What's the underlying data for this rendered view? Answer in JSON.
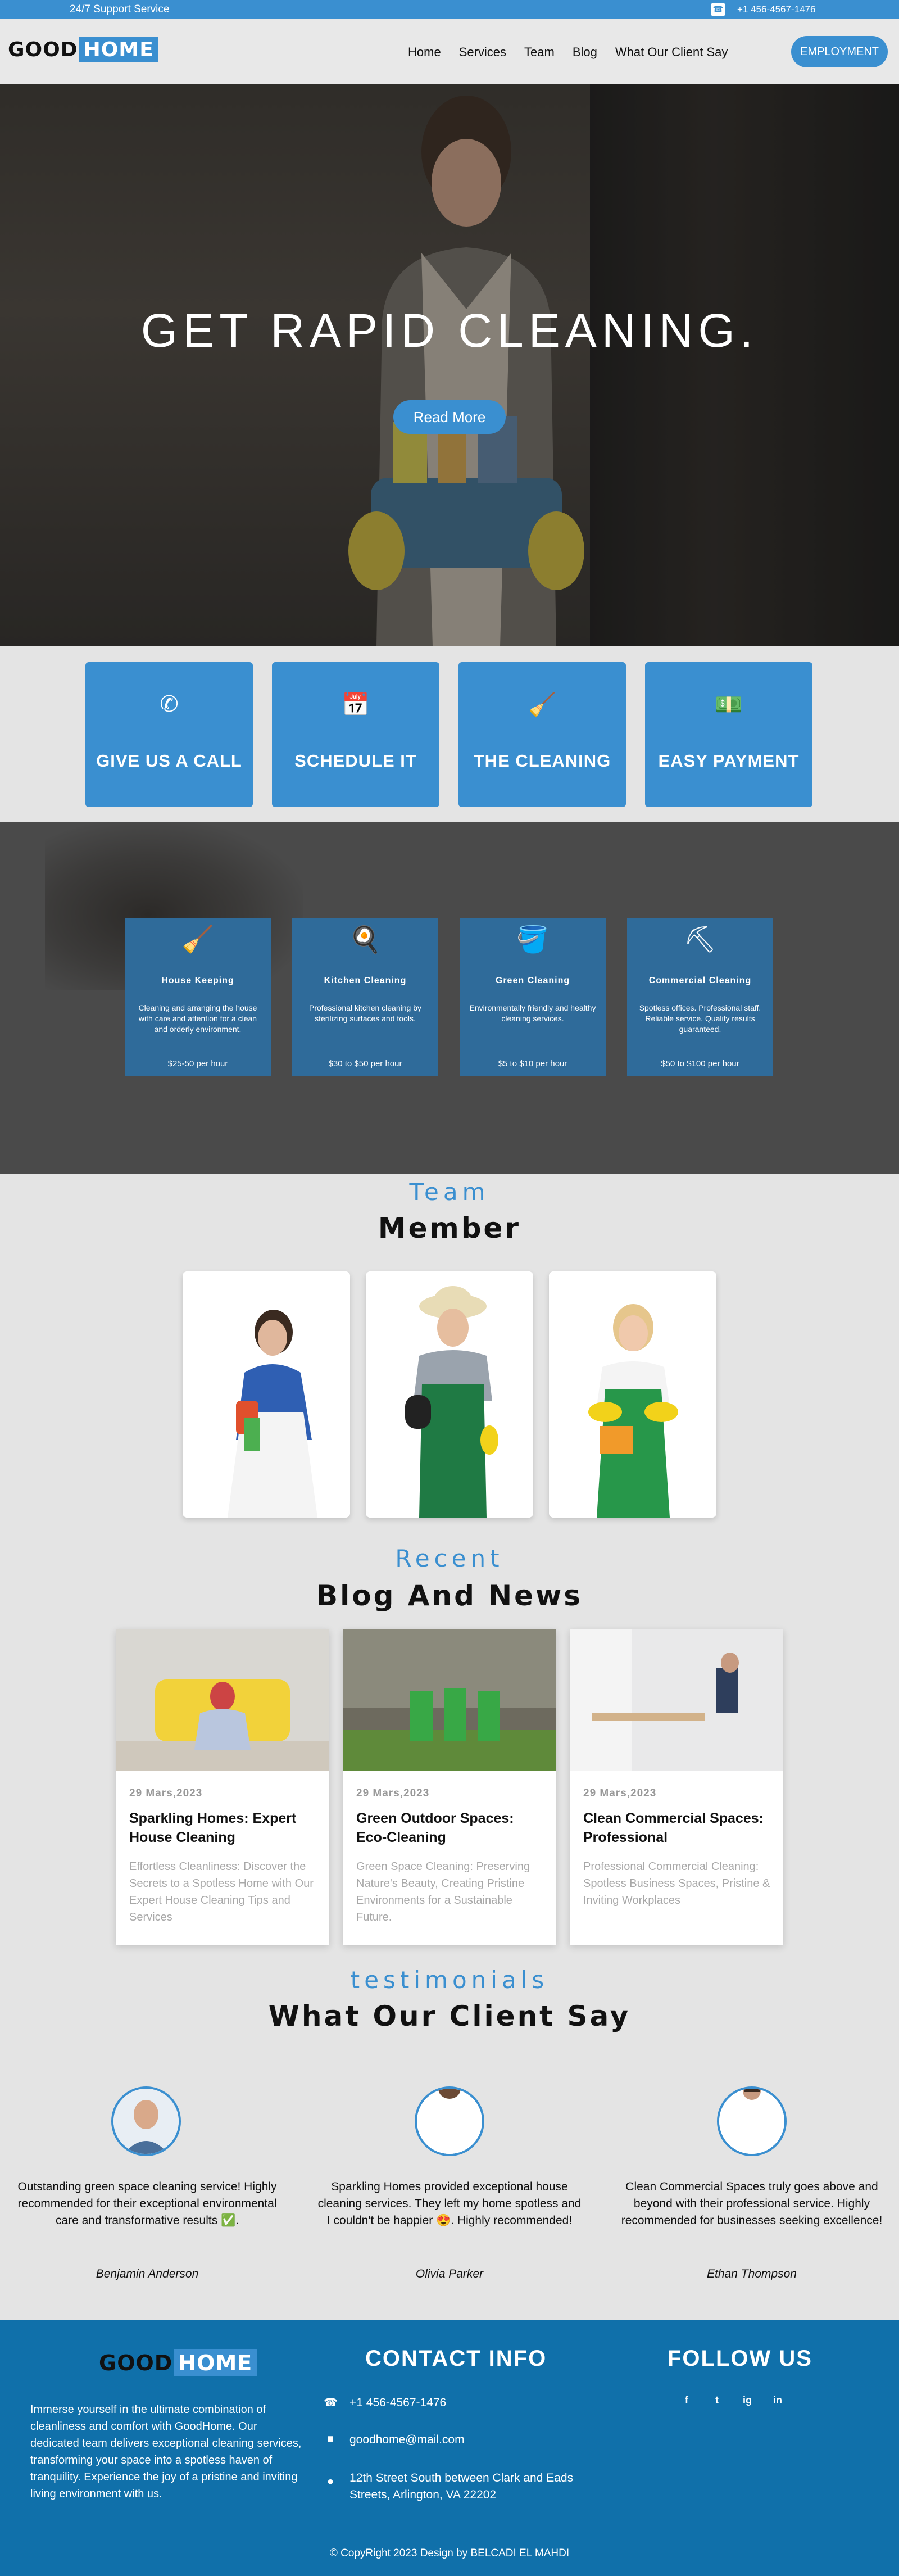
{
  "topbar": {
    "support": "24/7 Support Service",
    "phone": "+1 456-4567-1476",
    "phone_icon": "phone-icon"
  },
  "brand": {
    "good": "GOOD",
    "home": "HOME"
  },
  "nav": {
    "items": [
      "Home",
      "Services",
      "Team",
      "Blog",
      "What Our Client Say"
    ],
    "cta": "EMPLOYMENT"
  },
  "hero": {
    "title": "GET RAPID CLEANING.",
    "button": "Read More"
  },
  "features": [
    {
      "label": "GIVE US A CALL",
      "icon": "phone-call-icon"
    },
    {
      "label": "SCHEDULE IT",
      "icon": "calendar-check-icon"
    },
    {
      "label": "THE CLEANING",
      "icon": "broom-icon"
    },
    {
      "label": "EASY PAYMENT",
      "icon": "money-bill-icon"
    }
  ],
  "services": [
    {
      "title": "House Keeping",
      "desc": "Cleaning and arranging the house with care and attention for a clean and orderly environment.",
      "price": "$25-50 per hour",
      "icon": "cleaning-supplies-icon"
    },
    {
      "title": "Kitchen Cleaning",
      "desc": "Professional kitchen cleaning by sterilizing surfaces and tools.",
      "price": "$30 to $50 per hour",
      "icon": "kitchen-cleaning-icon"
    },
    {
      "title": "Green Cleaning",
      "desc": "Environmentally friendly and healthy cleaning services.",
      "price": "$5 to $10 per hour",
      "icon": "bucket-icon"
    },
    {
      "title": "Commercial Cleaning",
      "desc": "Spotless offices. Professional staff. Reliable service. Quality results guaranteed.",
      "price": "$50 to $100 per hour",
      "icon": "vacuum-icon"
    }
  ],
  "team": {
    "sub": "Team",
    "title": "Member"
  },
  "blog": {
    "sub": "Recent",
    "title": "Blog And News",
    "posts": [
      {
        "date": "29 Mars,2023",
        "title": "Sparkling Homes: Expert House Cleaning",
        "desc": "Effortless Cleanliness: Discover the Secrets to a Spotless Home with Our Expert House Cleaning Tips and Services"
      },
      {
        "date": "29 Mars,2023",
        "title": "Green Outdoor Spaces: Eco-Cleaning",
        "desc": "Green Space Cleaning: Preserving Nature's Beauty, Creating Pristine Environments for a Sustainable Future."
      },
      {
        "date": "29 Mars,2023",
        "title": "Clean Commercial Spaces: Professional",
        "desc": "Professional Commercial Cleaning: Spotless Business Spaces, Pristine & Inviting Workplaces"
      }
    ]
  },
  "testimonials": {
    "sub": "testimonials",
    "title": "What Our Client Say",
    "items": [
      {
        "quote": "Outstanding green space cleaning service! Highly recommended for their exceptional environmental care and transformative results ✅.",
        "name": "Benjamin Anderson"
      },
      {
        "quote": "Sparkling Homes provided exceptional house cleaning services. They left my home spotless and I couldn't be happier 😍. Highly recommended!",
        "name": "Olivia Parker"
      },
      {
        "quote": "Clean Commercial Spaces truly goes above and beyond with their professional service. Highly recommended for businesses seeking excellence!",
        "name": "Ethan Thompson"
      }
    ]
  },
  "footer": {
    "about": "Immerse yourself in the ultimate combination of cleanliness and comfort with GoodHome. Our dedicated team delivers exceptional cleaning services, transforming your space into a spotless haven of tranquility. Experience the joy of a pristine and inviting living environment with us.",
    "contact_title": "CONTACT INFO",
    "phone": "+1 456-4567-1476",
    "email": "goodhome@mail.com",
    "address": "12th Street South between Clark and Eads Streets, Arlington, VA 22202",
    "follow_title": "FOLLOW US",
    "social": [
      "f",
      "t",
      "ig",
      "in"
    ],
    "copyright": "© CopyRight 2023 Design by BELCADI EL MAHDI"
  }
}
